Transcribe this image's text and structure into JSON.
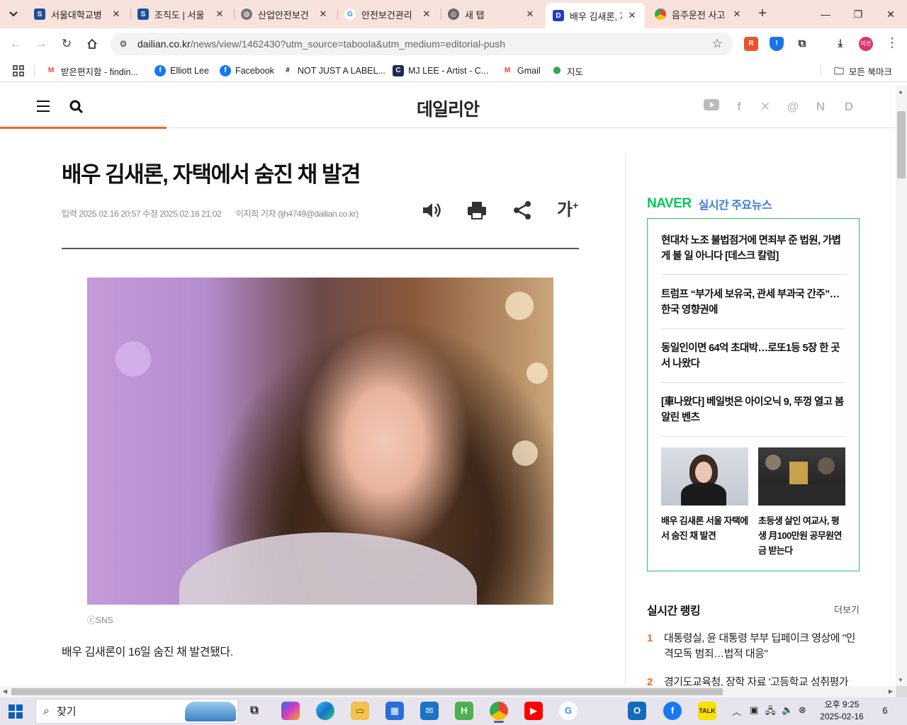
{
  "browser": {
    "tabs": [
      {
        "title": "서울대학교병",
        "icon": "snuh-shield-icon",
        "color": "#1f4f9f"
      },
      {
        "title": "조직도 | 서울",
        "icon": "snuh-shield-icon",
        "color": "#1f4f9f"
      },
      {
        "title": "산업안전보건",
        "icon": "globe-icon",
        "color": "#555555"
      },
      {
        "title": "안전보건관리",
        "icon": "google-g-icon",
        "color": "#4285f4"
      },
      {
        "title": "새 탭",
        "icon": "chrome-icon",
        "color": "#555555"
      },
      {
        "title": "배우 김새론, 자",
        "icon": "dailian-d-icon",
        "color": "#1f3fbf",
        "active": true
      },
      {
        "title": "음주운전 사고",
        "icon": "chrome-color-icon",
        "color": "#e8b400"
      }
    ],
    "url_host": "dailian.co.kr",
    "url_path": "/news/view/1462430?utm_source=taboola&utm_medium=editorial-push",
    "profile_label": "미진",
    "bookmarks": [
      {
        "label": "받은편지함 - findin...",
        "icon": "gmail-icon"
      },
      {
        "label": "Elliott Lee",
        "icon": "facebook-icon"
      },
      {
        "label": "Facebook",
        "icon": "facebook-icon"
      },
      {
        "label": "NOT JUST A LABEL...",
        "icon": "njal-icon"
      },
      {
        "label": "MJ LEE - Artist - C...",
        "icon": "c-icon"
      },
      {
        "label": "Gmail",
        "icon": "gmail-icon"
      },
      {
        "label": "지도",
        "icon": "maps-pin-icon"
      }
    ],
    "all_bookmarks": "모든 북마크"
  },
  "site": {
    "logo": "데일리안",
    "social": [
      "youtube-icon",
      "facebook-icon",
      "x-icon",
      "threads-icon",
      "naver-n-icon",
      "dailian-d-icon"
    ]
  },
  "article": {
    "headline": "배우 김새론, 자택에서 숨진 채 발견",
    "dates": "입력 2025.02.16 20:57 수정 2025.02.16 21:02",
    "byline": "이지희 기자 (ljh4749@dailian.co.kr)",
    "font_size_tool": "가",
    "photo_credit": "ⓒSNS",
    "lead": "배우 김새론이 16일 숨진 채 발견됐다."
  },
  "sidebar": {
    "naver_logo": "NAVER",
    "naver_title": "실시간 주요뉴스",
    "naver_items": [
      "현대차 노조 불법점거에 면죄부 준 법원, 가볍게 볼 일 아니다 [데스크 칼럼]",
      "트럼프 “부가세 보유국, 관세 부과국 간주”…한국 영향권에",
      "동일인이면 64억 초대박…로또1등 5장 한 곳서 나왔다",
      "[車나왔다] 베일벗은 아이오닉 9, 뚜껑 열고 봄 알린 벤츠"
    ],
    "naver_photos": [
      "배우 김새론 서울 자택에서 숨진 채 발견",
      "초등생 살인 여교사, 평생 月100만원 공무원연금 받는다"
    ],
    "ranking_title": "실시간 랭킹",
    "ranking_more": "더보기",
    "ranking": [
      {
        "no": "1",
        "title": "대통령실, 윤 대통령 부부 딥페이크 영상에 \"인격모독 범죄…법적 대응\""
      },
      {
        "no": "2",
        "title": "경기도교육청, 장학 자료 '고등학교 성취평가"
      }
    ]
  },
  "taskbar": {
    "search_placeholder": "찾기",
    "time": "오후 9:25",
    "date": "2025-02-16",
    "notifications": "6"
  },
  "colors": {
    "accent": "#e9692c",
    "naver_green": "#03c75a",
    "naver_title_blue": "#3b7bdb"
  }
}
